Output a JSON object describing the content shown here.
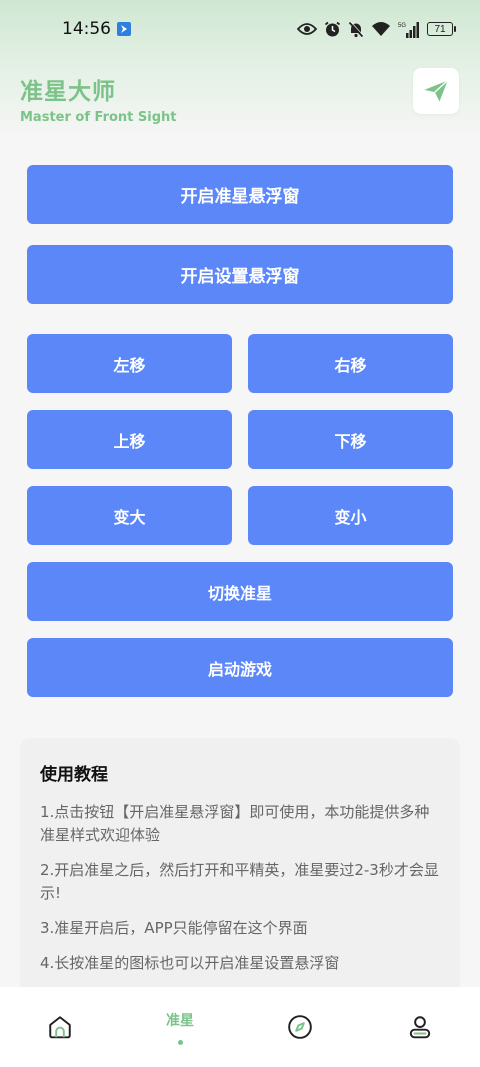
{
  "statusbar": {
    "time": "14:56",
    "battery": "71"
  },
  "header": {
    "title": "准星大师",
    "subtitle": "Master of Front Sight"
  },
  "buttons": {
    "open_crosshair": "开启准星悬浮窗",
    "open_settings": "开启设置悬浮窗",
    "move_left": "左移",
    "move_right": "右移",
    "move_up": "上移",
    "move_down": "下移",
    "bigger": "变大",
    "smaller": "变小",
    "switch": "切换准星",
    "launch": "启动游戏"
  },
  "tutorial": {
    "title": "使用教程",
    "steps": [
      "1.点击按钮【开启准星悬浮窗】即可使用，本功能提供多种准星样式欢迎体验",
      "2.开启准星之后，然后打开和平精英，准星要过2-3秒才会显示!",
      "3.准星开启后，APP只能停留在这个界面",
      "4.长按准星的图标也可以开启准星设置悬浮窗"
    ]
  },
  "nav": {
    "active_label": "准星"
  },
  "colors": {
    "accent_green": "#7cc389",
    "button_blue": "#5b87f9"
  }
}
